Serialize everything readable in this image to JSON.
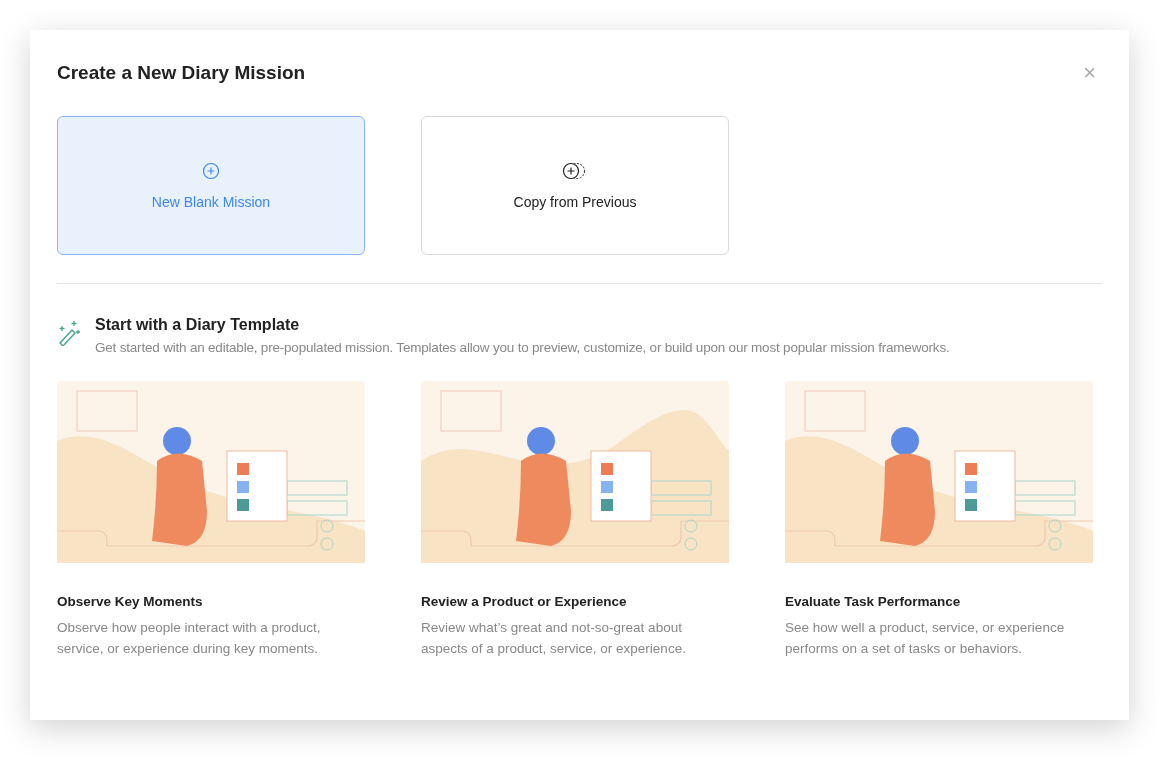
{
  "dialog": {
    "title": "Create a New Diary Mission",
    "close": "×"
  },
  "options": [
    {
      "kind": "blank",
      "label": "New Blank Mission",
      "selected": true
    },
    {
      "kind": "copy",
      "label": "Copy from Previous",
      "selected": false
    }
  ],
  "template_section": {
    "heading": "Start with a Diary Template",
    "description": "Get started with an editable, pre-populated mission. Templates allow you to preview, customize, or build upon our most popular mission frameworks."
  },
  "templates": [
    {
      "title": "Observe Key Moments",
      "description": "Observe how people interact with a product, service, or experience during key moments."
    },
    {
      "title": "Review a Product or Experience",
      "description": "Review what’s great and not-so-great about aspects of a product, service, or experience."
    },
    {
      "title": "Evaluate Task Performance",
      "description": "See how well a product, service, or experience performs on a set of tasks or behaviors."
    }
  ]
}
